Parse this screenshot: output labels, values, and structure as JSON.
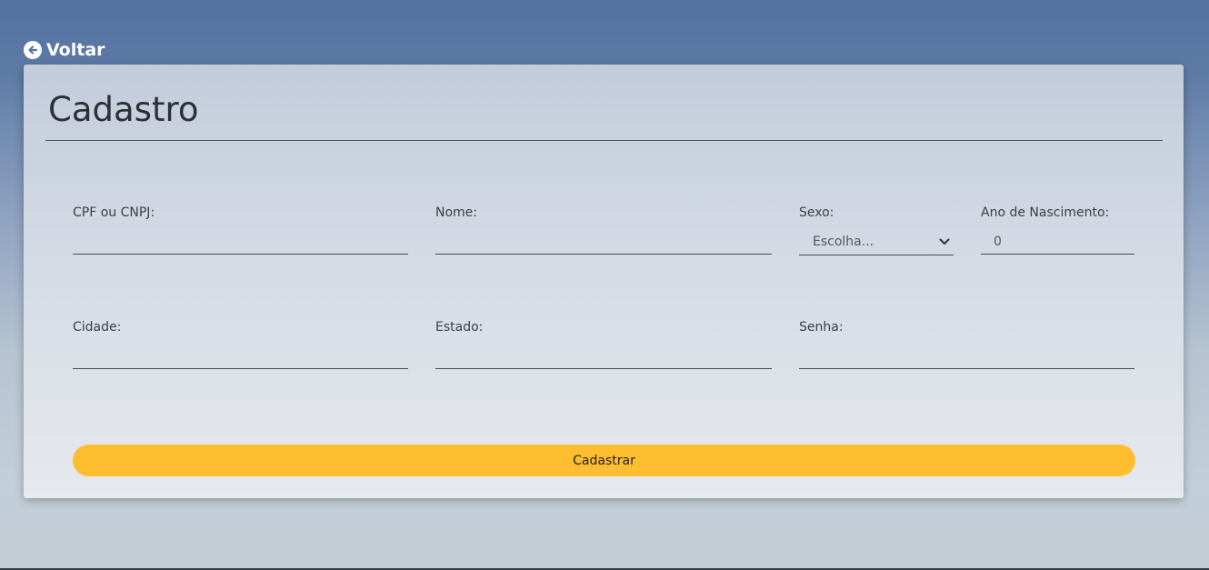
{
  "nav": {
    "back_label": "Voltar",
    "back_icon": "arrow-left-circle-icon"
  },
  "form": {
    "title": "Cadastro",
    "fields": {
      "cpf": {
        "label": "CPF ou CNPJ:",
        "value": ""
      },
      "nome": {
        "label": "Nome:",
        "value": ""
      },
      "sexo": {
        "label": "Sexo:",
        "selected": "Escolha..."
      },
      "ano": {
        "label": "Ano de Nascimento:",
        "value": "0"
      },
      "cidade": {
        "label": "Cidade:",
        "value": ""
      },
      "estado": {
        "label": "Estado:",
        "value": ""
      },
      "senha": {
        "label": "Senha:",
        "value": ""
      }
    },
    "submit_label": "Cadastrar"
  },
  "colors": {
    "accent_button": "#ffbe2f",
    "background_top": "#5472a2",
    "card": "#d4dbe5"
  }
}
